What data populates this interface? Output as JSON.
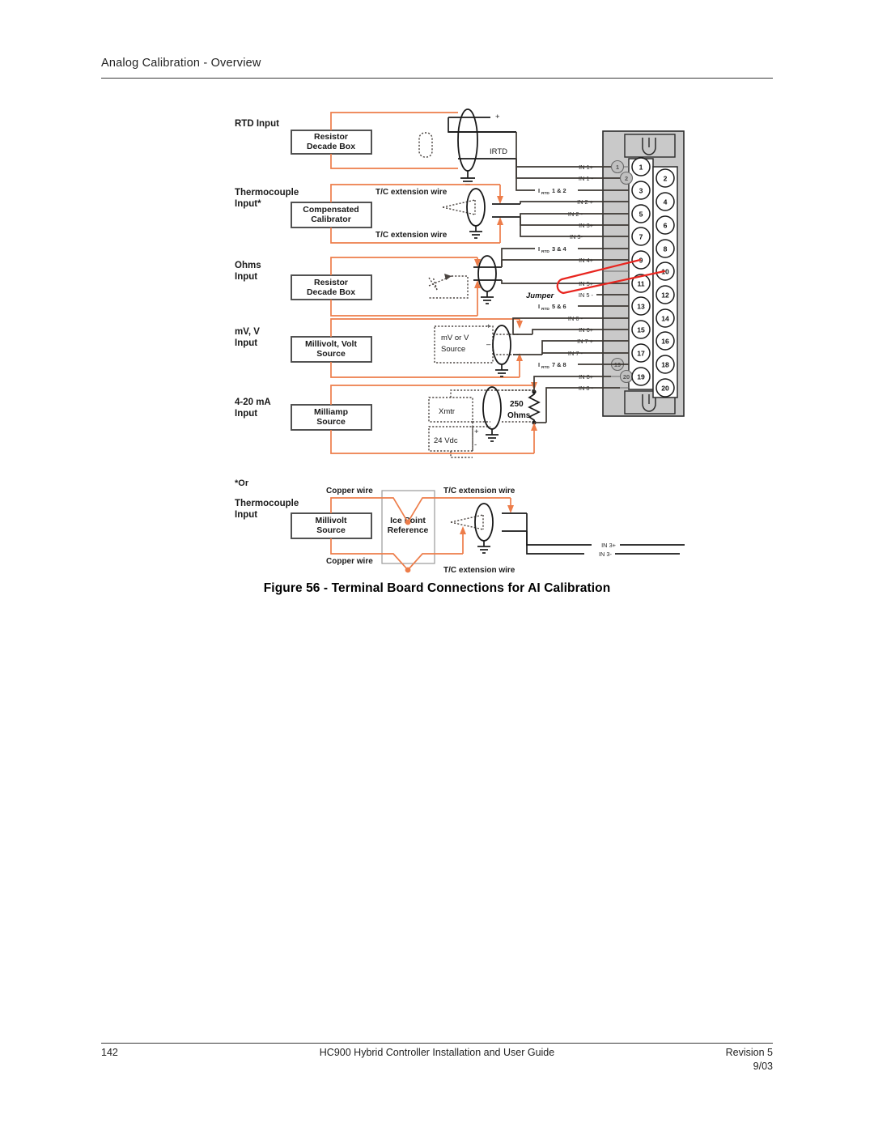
{
  "header": {
    "running_head": "Analog Calibration - Overview"
  },
  "footer": {
    "page_number": "142",
    "guide_title": "HC900 Hybrid Controller Installation and User Guide",
    "revision": "Revision 5",
    "date": "9/03"
  },
  "figure": {
    "caption": "Figure 56 - Terminal Board Connections for AI Calibration",
    "sections": [
      {
        "id": "rtd",
        "label_line1": "RTD Input",
        "label_line2": "",
        "box_line1": "Resistor",
        "box_line2": "Decade Box"
      },
      {
        "id": "tc",
        "label_line1": "Thermocouple",
        "label_line2": "Input*",
        "box_line1": "Compensated",
        "box_line2": "Calibrator"
      },
      {
        "id": "ohms",
        "label_line1": "Ohms",
        "label_line2": "Input",
        "box_line1": "Resistor",
        "box_line2": "Decade Box"
      },
      {
        "id": "mv",
        "label_line1": "mV, V",
        "label_line2": "Input",
        "box_line1": "Millivolt, Volt",
        "box_line2": "Source"
      },
      {
        "id": "ma",
        "label_line1": "4-20 mA",
        "label_line2": "Input",
        "box_line1": "Milliamp",
        "box_line2": "Source"
      }
    ],
    "alt_section": {
      "note": "*Or",
      "label_line1": "Thermocouple",
      "label_line2": "Input",
      "box_line1": "Millivolt",
      "box_line2": "Source",
      "ref_line1": "Ice Point",
      "ref_line2": "Reference",
      "wire_top_left": "Copper wire",
      "wire_bottom_left": "Copper wire",
      "wire_top_right": "T/C extension wire",
      "wire_bottom_right": "T/C extension wire",
      "terminal_top": "IN 3+",
      "terminal_bottom": "IN 3-"
    },
    "wire_labels": {
      "tc_top": "T/C extension wire",
      "tc_bottom": "T/C extension wire",
      "irtd": "IRTD",
      "plus": "+",
      "minus": "-"
    },
    "inline_boxes": {
      "mv_source_line1": "mV or V",
      "mv_source_line2": "Source",
      "mv_plus": "+",
      "mv_minus": "–",
      "xmtr": "Xmtr",
      "vdc": "24 Vdc",
      "vdc_plus": "+",
      "vdc_minus": "-",
      "resistor_line1": "250",
      "resistor_line2": "Ohms"
    },
    "jumper_label": "Jumper",
    "terminal_labels": [
      {
        "num": "1",
        "text": "IN 1+",
        "sub": ""
      },
      {
        "num": "2",
        "text": "IN 1 -",
        "sub": ""
      },
      {
        "num": "3",
        "text": "1 & 2",
        "sub": "RTD",
        "prefix": "I"
      },
      {
        "num": "4",
        "text": "IN 2 +",
        "sub": ""
      },
      {
        "num": "5",
        "text": "IN 2 -",
        "sub": ""
      },
      {
        "num": "6",
        "text": "IN 3+",
        "sub": ""
      },
      {
        "num": "7",
        "text": "IN 3-",
        "sub": ""
      },
      {
        "num": "8",
        "text": "3 & 4",
        "sub": "RTD",
        "prefix": "I"
      },
      {
        "num": "9",
        "text": "IN 4+",
        "sub": ""
      },
      {
        "num": "10",
        "text": "IN 5+",
        "sub": ""
      },
      {
        "num": "11",
        "text": "IN 5 -",
        "sub": ""
      },
      {
        "num": "12",
        "text": "5 & 6",
        "sub": "RTD",
        "prefix": "I"
      },
      {
        "num": "13",
        "text": "IN 6+",
        "sub": ""
      },
      {
        "num": "14",
        "text": "IN 6 -",
        "sub": ""
      },
      {
        "num": "15",
        "text": "IN 7 +",
        "sub": ""
      },
      {
        "num": "16",
        "text": "IN 7 -",
        "sub": ""
      },
      {
        "num": "17",
        "text": "7 & 8",
        "sub": "RTD",
        "prefix": "I"
      },
      {
        "num": "18",
        "text": "IN 8+",
        "sub": ""
      },
      {
        "num": "19",
        "text": "IN 8 -",
        "sub": ""
      }
    ],
    "terminal_numbers_left": [
      "1",
      "3",
      "5",
      "7",
      "9",
      "11",
      "13",
      "15",
      "17",
      "19"
    ],
    "terminal_numbers_right": [
      "2",
      "4",
      "6",
      "8",
      "10",
      "12",
      "14",
      "16",
      "18",
      "20"
    ],
    "terminal_ghosts": [
      "1",
      "2",
      "19",
      "20"
    ],
    "colors": {
      "wire_orange": "#ED7D4A",
      "wire_dark": "#3d3833",
      "jumper_red": "#E8251F",
      "board_gray": "#c9c9c9"
    }
  }
}
